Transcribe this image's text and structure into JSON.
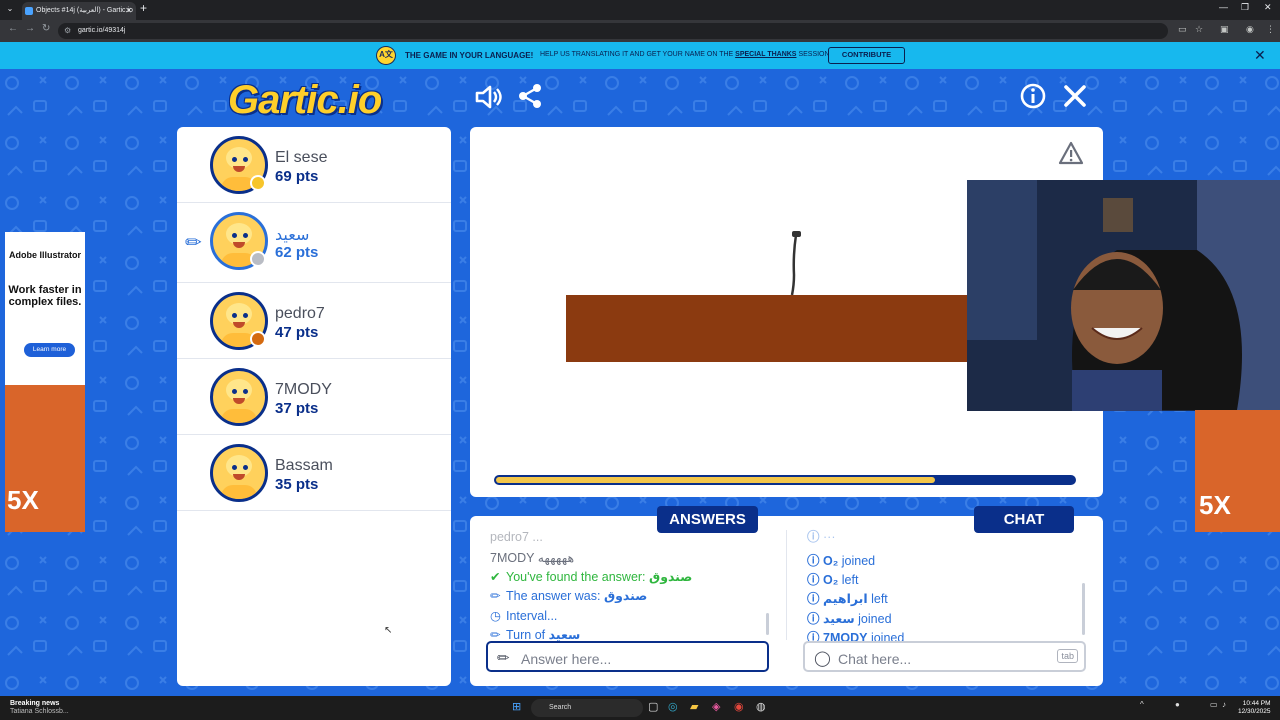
{
  "browser": {
    "tab_title": "Objects #14j (العربية) - Gartic.io",
    "url": "gartic.io/49314j"
  },
  "banner": {
    "headline": "THE GAME IN YOUR LANGUAGE!",
    "text_before": "HELP US TRANSLATING IT AND GET YOUR NAME ON THE",
    "text_link": "SPECIAL THANKS",
    "text_after": "SESSION",
    "button": "CONTRIBUTE"
  },
  "header": {
    "logo": "Gartic.io"
  },
  "players": [
    {
      "name": "El sese",
      "score": "69 pts",
      "dot_color": "#f7c52b",
      "active": false
    },
    {
      "name": "سعيد",
      "score": "62 pts",
      "dot_color": "#b9bcc4",
      "active": true
    },
    {
      "name": "pedro7",
      "score": "47 pts",
      "dot_color": "#d46a10",
      "active": false
    },
    {
      "name": "7MODY",
      "score": "37 pts",
      "dot_color": null,
      "active": false
    },
    {
      "name": "Bassam",
      "score": "35 pts",
      "dot_color": null,
      "active": false
    }
  ],
  "canvas": {
    "timer_fraction": 0.76
  },
  "answers": {
    "tab_label": "ANSWERS",
    "messages": [
      {
        "text": "pedro7 ..."
      },
      {
        "text": "7MODY هههههه"
      },
      {
        "prefix": "You've found the answer:",
        "value": "صندوق"
      },
      {
        "prefix": "The answer was:",
        "value": "صندوق"
      },
      {
        "prefix": "Interval..."
      },
      {
        "prefix": "Turn of",
        "value": "سعيد"
      }
    ],
    "input_placeholder": "Answer here..."
  },
  "chat": {
    "tab_label": "CHAT",
    "messages": [
      {
        "name": "O₂",
        "action": "joined"
      },
      {
        "name": "O₂",
        "action": "left"
      },
      {
        "name": "ابراهيم",
        "action": "left"
      },
      {
        "name": "سعيد",
        "action": "joined"
      },
      {
        "name": "7MODY",
        "action": "joined"
      }
    ],
    "input_placeholder": "Chat here...",
    "key_hint": "tab"
  },
  "ad": {
    "brand": "Adobe Illustrator",
    "body": "Work faster in complex files.",
    "button": "Learn more",
    "art_text": "5X"
  },
  "taskbar": {
    "news_title": "Breaking news",
    "news_sub": "Tatiana Schlossb...",
    "search": "Search",
    "time": "10:44 PM",
    "date": "12/30/2025"
  },
  "colors": {
    "bg": "#1e66dc",
    "navy": "#0a2f8a",
    "accent_blue": "#2a6fd8",
    "found_green": "#2fb63e",
    "banner": "#17b8ee"
  }
}
